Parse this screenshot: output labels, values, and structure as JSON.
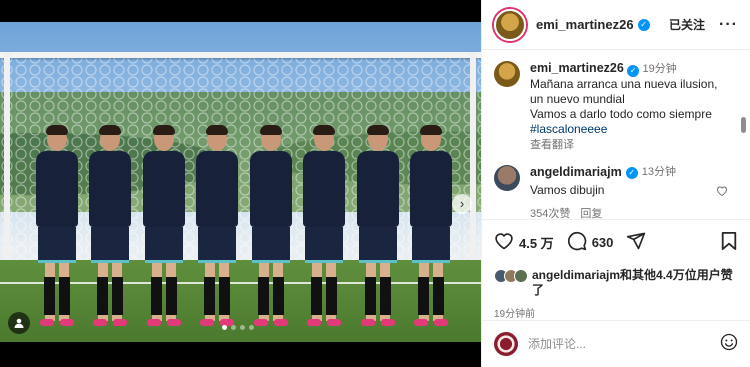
{
  "post": {
    "username": "emi_martinez26",
    "follow_state": "已关注",
    "more_label": "···",
    "caption": {
      "username": "emi_martinez26",
      "time": "19分钟",
      "lines": [
        "Mañana arranca una nueva ilusion,",
        "un nuevo mundial",
        "Vamos a darlo todo como siempre"
      ],
      "hashtag": "#lascaloneeee",
      "translate": "查看翻译"
    },
    "top_comment": {
      "username": "angeldimariajm",
      "time": "13分钟",
      "text": "Vamos dibujin",
      "likes": "354次赞",
      "reply": "回复"
    },
    "actions": {
      "likes_count": "4.5 万",
      "comments_count": "630"
    },
    "liked_by": "angeldimariajm和其他4.4万位用户赞了",
    "posted_ago": "19分钟前",
    "comment_placeholder": "添加评论...",
    "media": {
      "slide_count": 4,
      "active_slide": 1
    }
  },
  "icons": {
    "verified": "verified-badge-icon",
    "heart": "heart-icon",
    "comment": "comment-icon",
    "share": "share-icon",
    "save": "bookmark-icon",
    "emoji": "emoji-icon",
    "next": "chevron-right-icon",
    "tag": "user-tag-icon"
  },
  "colors": {
    "link": "#00376b",
    "verified": "#0095f6",
    "muted": "#737373"
  }
}
